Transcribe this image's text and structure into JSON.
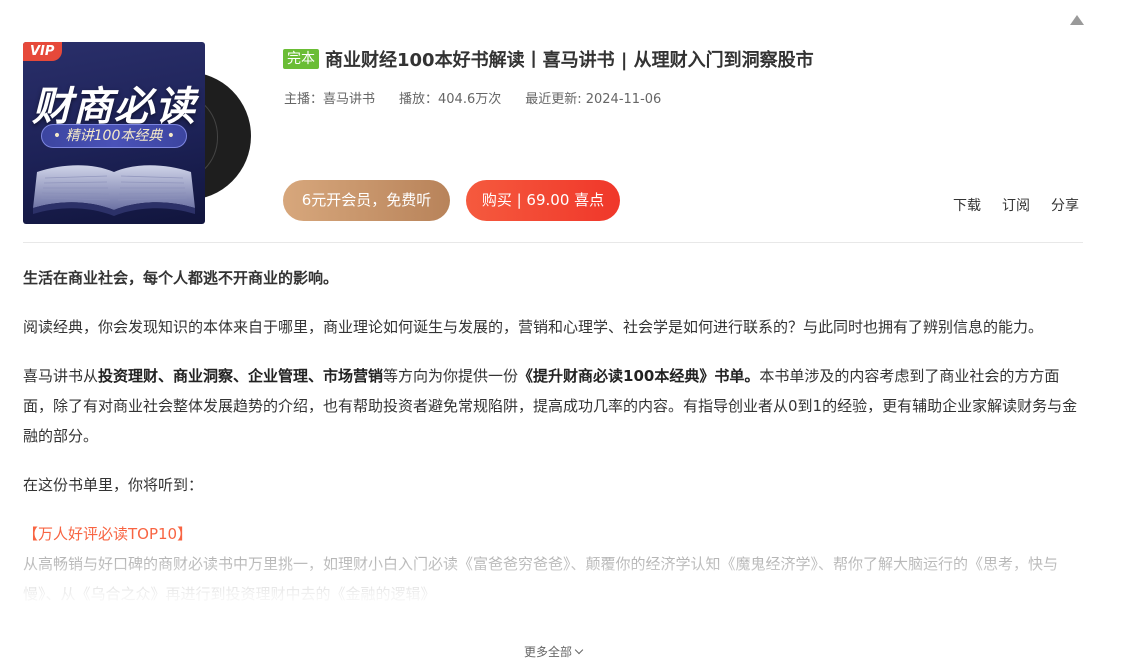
{
  "cover": {
    "vip_badge": "VIP",
    "title": "财商必读",
    "subtitle": "• 精讲100本经典 •"
  },
  "album": {
    "status_tag": "完本",
    "title": "商业财经100本好书解读丨喜马讲书 | 从理财入门到洞察股市",
    "host": "主播：喜马讲书",
    "plays": "播放：404.6万次",
    "updated": "最近更新: 2024-11-06"
  },
  "buttons": {
    "vip": "6元开会员，免费听",
    "buy": "购买 | 69.00 喜点"
  },
  "actions": {
    "download": "下载",
    "subscribe": "订阅",
    "share": "分享"
  },
  "description": {
    "lead": "生活在商业社会，每个人都逃不开商业的影响。",
    "p1": "阅读经典，你会发现知识的本体来自于哪里，商业理论如何诞生与发展的，营销和心理学、社会学是如何进行联系的？与此同时也拥有了辨别信息的能力。",
    "p2_a": "喜马讲书从",
    "p2_b": "投资理财、商业洞察、企业管理、市场营销",
    "p2_c": "等方向为你提供一份",
    "p2_d": "《提升财商必读100本经典》书单。",
    "p2_e": "本书单涉及的内容考虑到了商业社会的方方面面，除了有对商业社会整体发展趋势的介绍，也有帮助投资者避免常规陷阱，提高成功几率的内容。有指导创业者从0到1的经验，更有辅助企业家解读财务与金融的部分。",
    "p3": "在这份书单里，你将听到：",
    "section_title": "【万人好评必读TOP10】",
    "p4": "从高畅销与好口碑的商财必读书中万里挑一，如理财小白入门必读《富爸爸穷爸爸》、颠覆你的经济学认知《魔鬼经济学》、帮你了解大脑运行的《思考，快与慢》、从《乌合之众》再进行到投资理财中去的《金融的逻辑》"
  },
  "more_label": "更多全部",
  "colors": {
    "done_tag": "#6abd35",
    "buy": "#f0372a",
    "vip": "#c49068",
    "section_title": "#f86442"
  }
}
